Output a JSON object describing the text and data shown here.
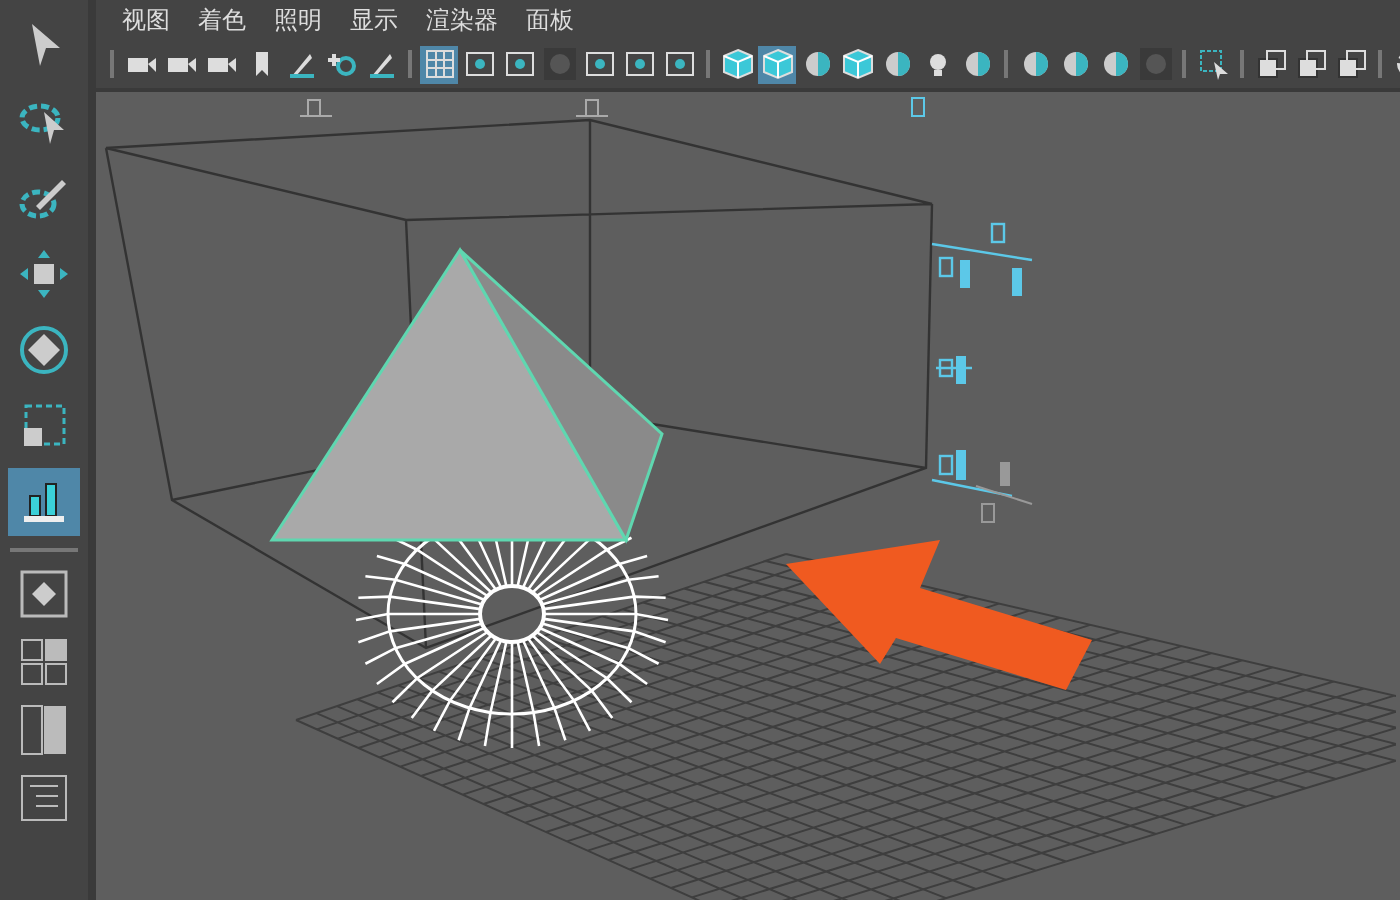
{
  "menu": [
    "视图",
    "着色",
    "照明",
    "显示",
    "渲染器",
    "面板"
  ],
  "toolbar_groups": [
    [
      {
        "kind": "camera",
        "selected": false
      },
      {
        "kind": "camera",
        "selected": false
      },
      {
        "kind": "camera",
        "selected": false
      },
      {
        "kind": "bookmark",
        "selected": false
      },
      {
        "kind": "pen",
        "selected": false
      },
      {
        "kind": "zoom",
        "selected": false
      },
      {
        "kind": "pen",
        "selected": false
      }
    ],
    [
      {
        "kind": "grid",
        "selected": true
      },
      {
        "kind": "frame",
        "selected": false
      },
      {
        "kind": "frame",
        "selected": false
      },
      {
        "kind": "disc",
        "selected": false
      },
      {
        "kind": "frame",
        "selected": false
      },
      {
        "kind": "frame",
        "selected": false
      },
      {
        "kind": "frame",
        "selected": false
      }
    ],
    [
      {
        "kind": "cube",
        "selected": false
      },
      {
        "kind": "cube",
        "selected": true
      },
      {
        "kind": "sphere",
        "selected": false
      },
      {
        "kind": "cube",
        "selected": false
      },
      {
        "kind": "sphere",
        "selected": false
      },
      {
        "kind": "bulb",
        "selected": false
      },
      {
        "kind": "sphere",
        "selected": false
      }
    ],
    [
      {
        "kind": "sphere",
        "selected": false
      },
      {
        "kind": "sphere",
        "selected": false
      },
      {
        "kind": "sphere",
        "selected": false
      },
      {
        "kind": "disc",
        "selected": false
      }
    ],
    [
      {
        "kind": "cursor",
        "selected": false
      }
    ],
    [
      {
        "kind": "square",
        "selected": false
      },
      {
        "kind": "square",
        "selected": false
      },
      {
        "kind": "square",
        "selected": false
      }
    ],
    [
      {
        "kind": "refresh",
        "selected": false
      }
    ]
  ],
  "tools": [
    {
      "kind": "arrow",
      "selected": false
    },
    {
      "kind": "lasso",
      "selected": false
    },
    {
      "kind": "paint",
      "selected": false
    },
    {
      "kind": "move",
      "selected": false
    },
    {
      "kind": "rotate",
      "selected": false
    },
    {
      "kind": "scale",
      "selected": false
    },
    {
      "kind": "graph",
      "selected": true
    }
  ],
  "layouts": [
    {
      "kind": "single"
    },
    {
      "kind": "four"
    },
    {
      "kind": "two"
    },
    {
      "kind": "outliner"
    }
  ]
}
